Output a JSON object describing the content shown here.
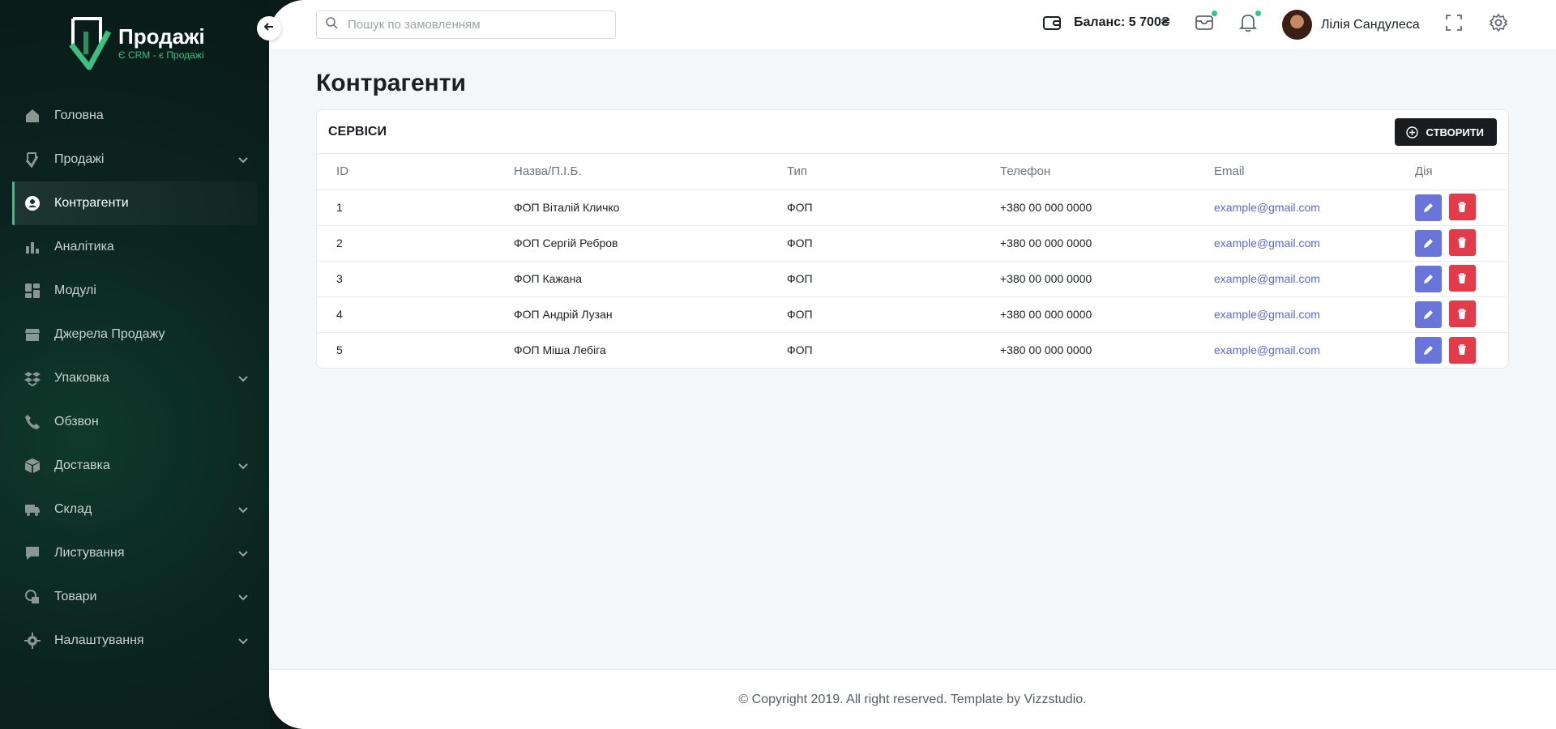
{
  "brand": {
    "title": "Продажі",
    "subtitle": "Є CRM - є Продажі",
    "accent": "#3fbf7f"
  },
  "sidebar": {
    "items": [
      {
        "label": "Головна",
        "icon": "home-icon",
        "has_children": false,
        "active": false
      },
      {
        "label": "Продажі",
        "icon": "sales-icon",
        "has_children": true,
        "active": false
      },
      {
        "label": "Контрагенти",
        "icon": "contractor-icon",
        "has_children": false,
        "active": true
      },
      {
        "label": "Аналітика",
        "icon": "chart-icon",
        "has_children": false,
        "active": false
      },
      {
        "label": "Модулі",
        "icon": "modules-icon",
        "has_children": false,
        "active": false
      },
      {
        "label": "Джерела Продажу",
        "icon": "store-icon",
        "has_children": false,
        "active": false
      },
      {
        "label": "Упаковка",
        "icon": "dropbox-icon",
        "has_children": true,
        "active": false
      },
      {
        "label": "Обзвон",
        "icon": "phone-icon",
        "has_children": false,
        "active": false
      },
      {
        "label": "Доставка",
        "icon": "box-icon",
        "has_children": true,
        "active": false
      },
      {
        "label": "Склад",
        "icon": "truck-icon",
        "has_children": true,
        "active": false
      },
      {
        "label": "Листування",
        "icon": "chat-icon",
        "has_children": true,
        "active": false
      },
      {
        "label": "Товари",
        "icon": "products-icon",
        "has_children": true,
        "active": false
      },
      {
        "label": "Налаштування",
        "icon": "gear-icon",
        "has_children": true,
        "active": false
      }
    ]
  },
  "header": {
    "search_placeholder": "Пошук по замовленням",
    "balance": "Баланс: 5 700₴",
    "user_name": "Лілія Сандулеса"
  },
  "page": {
    "title": "Контрагенти"
  },
  "card": {
    "title": "СЕРВІСИ",
    "create_label": "СТВОРИТИ",
    "columns": [
      "ID",
      "Назва/П.І.Б.",
      "Тип",
      "Телефон",
      "Email",
      "Дія"
    ],
    "rows": [
      {
        "id": "1",
        "name": "ФОП Віталій Кличко",
        "type": "ФОП",
        "phone": "+380 00 000 0000",
        "email": "example@gmail.com"
      },
      {
        "id": "2",
        "name": "ФОП Сергій Ребров",
        "type": "ФОП",
        "phone": "+380 00 000 0000",
        "email": "example@gmail.com"
      },
      {
        "id": "3",
        "name": "ФОП Кажана",
        "type": "ФОП",
        "phone": "+380 00 000 0000",
        "email": "example@gmail.com"
      },
      {
        "id": "4",
        "name": "ФОП Андрій Лузан",
        "type": "ФОП",
        "phone": "+380 00 000 0000",
        "email": "example@gmail.com"
      },
      {
        "id": "5",
        "name": "ФОП Міша Лебіга",
        "type": "ФОП",
        "phone": "+380 00 000 0000",
        "email": "example@gmail.com"
      }
    ]
  },
  "footer": {
    "text": "© Copyright 2019. All right reserved. Template by Vizzstudio."
  },
  "colors": {
    "edit": "#6975d9",
    "delete": "#e23b4a",
    "link": "#5a6bd0",
    "notification_dot": "#2dc68a"
  }
}
